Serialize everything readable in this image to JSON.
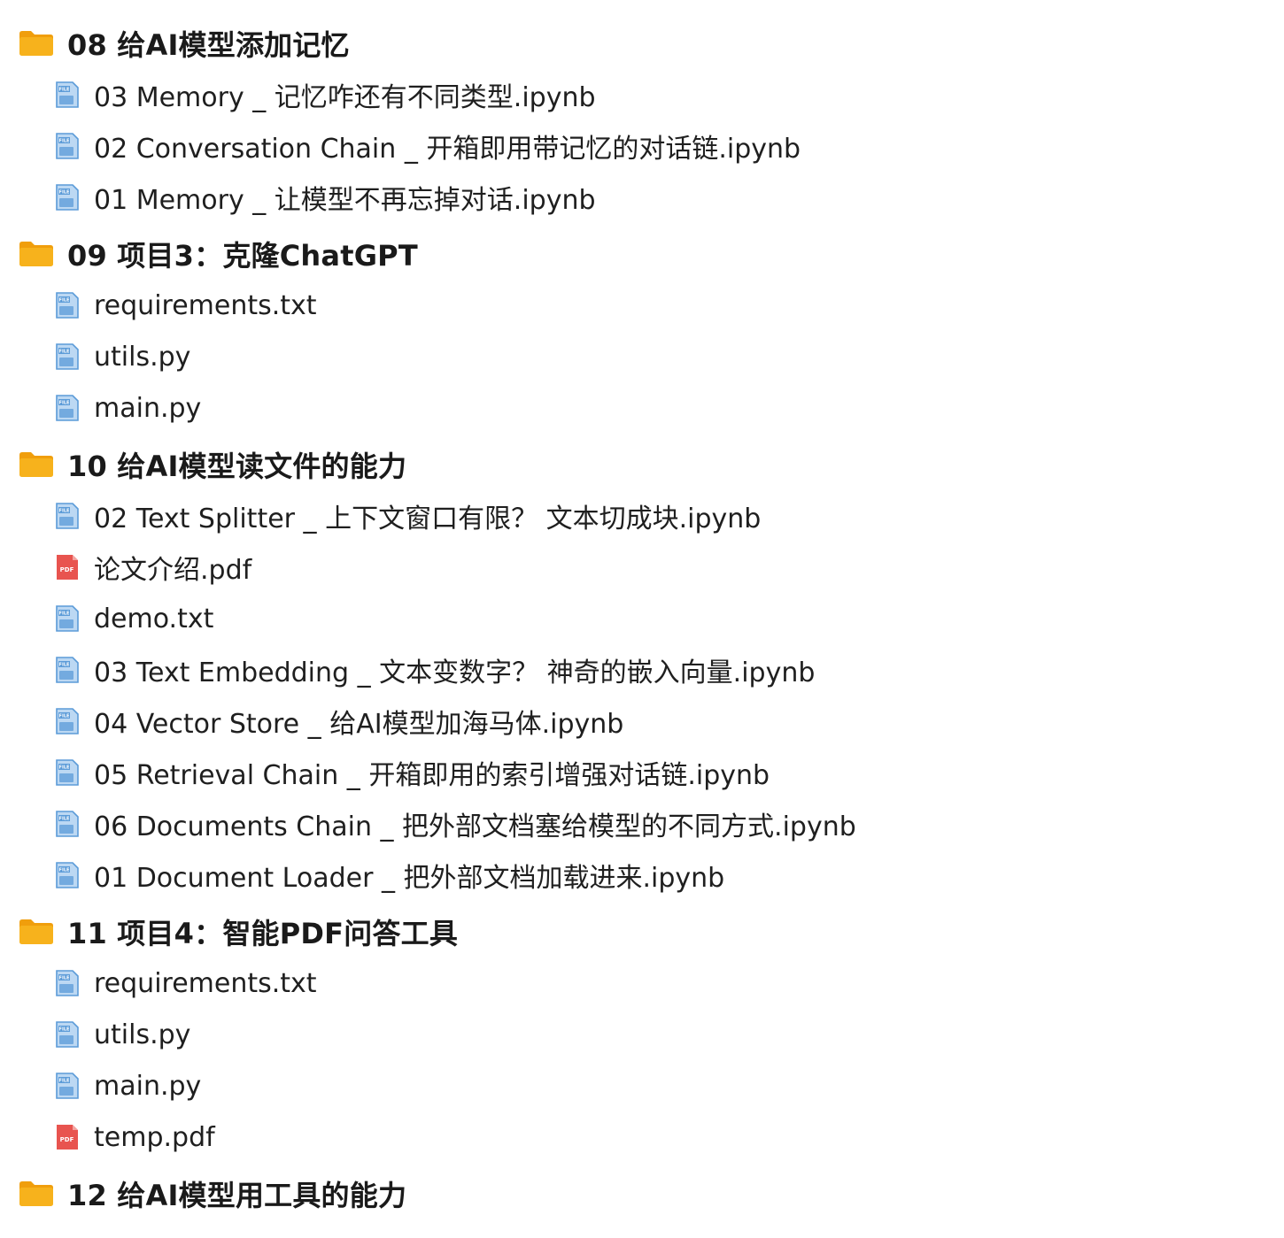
{
  "folders": [
    {
      "title": "08 给AI模型添加记忆",
      "files": [
        {
          "name": "03 Memory _ 记忆咋还有不同类型.ipynb",
          "type": "file"
        },
        {
          "name": "02 Conversation Chain _ 开箱即用带记忆的对话链.ipynb",
          "type": "file"
        },
        {
          "name": "01 Memory _ 让模型不再忘掉对话.ipynb",
          "type": "file"
        }
      ]
    },
    {
      "title": "09 项目3：克隆ChatGPT",
      "files": [
        {
          "name": "requirements.txt",
          "type": "file"
        },
        {
          "name": "utils.py",
          "type": "file"
        },
        {
          "name": "main.py",
          "type": "file"
        }
      ]
    },
    {
      "title": "10 给AI模型读文件的能力",
      "files": [
        {
          "name": "02 Text Splitter _ 上下文窗口有限？ 文本切成块.ipynb",
          "type": "file"
        },
        {
          "name": "论文介绍.pdf",
          "type": "pdf"
        },
        {
          "name": "demo.txt",
          "type": "file"
        },
        {
          "name": "03 Text Embedding _ 文本变数字？ 神奇的嵌入向量.ipynb",
          "type": "file"
        },
        {
          "name": "04 Vector Store _ 给AI模型加海马体.ipynb",
          "type": "file"
        },
        {
          "name": "05 Retrieval Chain _ 开箱即用的索引增强对话链.ipynb",
          "type": "file"
        },
        {
          "name": "06 Documents Chain _ 把外部文档塞给模型的不同方式.ipynb",
          "type": "file"
        },
        {
          "name": "01 Document Loader _ 把外部文档加载进来.ipynb",
          "type": "file"
        }
      ]
    },
    {
      "title": "11 项目4：智能PDF问答工具",
      "files": [
        {
          "name": "requirements.txt",
          "type": "file"
        },
        {
          "name": "utils.py",
          "type": "file"
        },
        {
          "name": "main.py",
          "type": "file"
        },
        {
          "name": "temp.pdf",
          "type": "pdf"
        }
      ]
    },
    {
      "title": "12 给AI模型用工具的能力",
      "files": []
    }
  ],
  "icons": {
    "folder": "folder-icon",
    "file": "file-icon",
    "pdf": "pdf-icon",
    "file_label": "FILE",
    "pdf_label": "PDF"
  },
  "colors": {
    "folder_body": "#f7b21c",
    "folder_tab": "#f09e0c",
    "file_icon": "#5b9bd8",
    "file_icon_light": "#bcd8f3",
    "pdf_icon": "#e8544f"
  }
}
